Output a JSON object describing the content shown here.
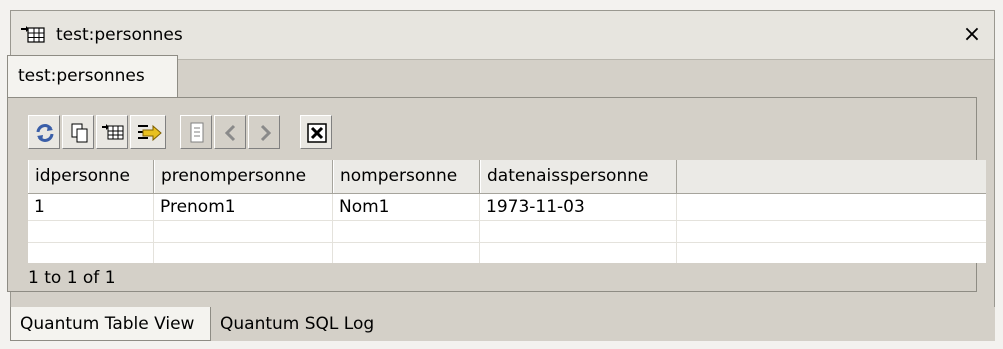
{
  "view": {
    "title": "test:personnes",
    "tab_label": "test:personnes",
    "close_glyph": "×"
  },
  "toolbar": {
    "buttons": [
      {
        "name": "refresh-icon"
      },
      {
        "name": "copy-icon"
      },
      {
        "name": "table-view-icon"
      },
      {
        "name": "export-icon"
      },
      {
        "name": "page-icon"
      },
      {
        "name": "previous-icon"
      },
      {
        "name": "next-icon"
      },
      {
        "name": "delete-icon"
      }
    ]
  },
  "grid": {
    "columns": [
      "idpersonne",
      "prenompersonne",
      "nompersonne",
      "datenaisspersonne"
    ],
    "rows": [
      [
        "1",
        "Prenom1",
        "Nom1",
        "1973-11-03"
      ],
      [
        "",
        "",
        "",
        ""
      ],
      [
        "",
        "",
        "",
        ""
      ]
    ]
  },
  "status": "1 to 1 of 1",
  "bottom_tabs": [
    "Quantum Table View",
    "Quantum SQL Log"
  ]
}
